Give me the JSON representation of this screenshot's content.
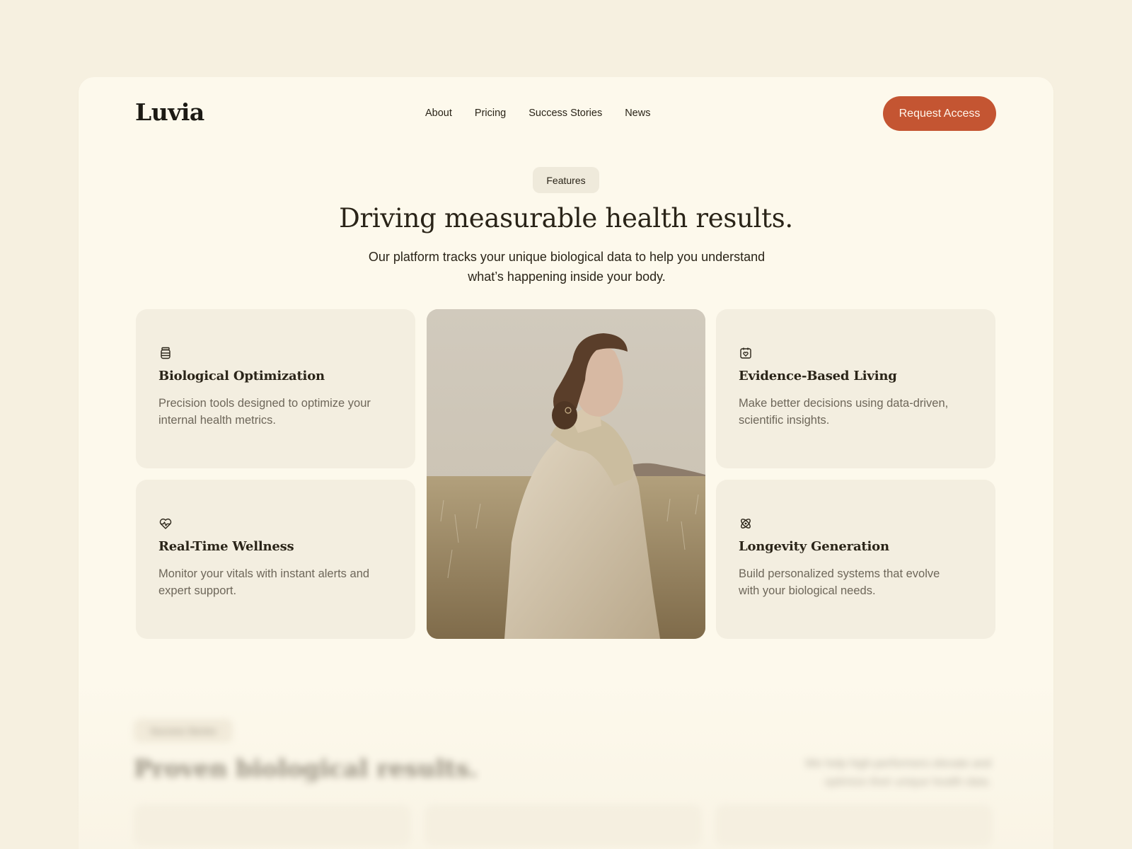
{
  "header": {
    "logo": "Luvia",
    "nav": [
      "About",
      "Pricing",
      "Success Stories",
      "News"
    ],
    "cta_label": "Request Access"
  },
  "hero": {
    "pill": "Features",
    "headline": "Driving measurable health results.",
    "subtitle_line1": "Our platform tracks your unique biological data to help you understand",
    "subtitle_line2": "what’s happening inside your body."
  },
  "features": [
    {
      "icon": "jar-icon",
      "title": "Biological Optimization",
      "text_line1": "Precision tools designed to optimize your",
      "text_line2": "internal health metrics."
    },
    {
      "icon": "calendar-heart-icon",
      "title": "Evidence-Based Living",
      "text_line1": "Make better decisions using data-driven,",
      "text_line2": "scientific insights."
    },
    {
      "icon": "heart-pulse-icon",
      "title": "Real-Time Wellness",
      "text_line1": "Monitor your vitals with instant alerts and",
      "text_line2": "expert support."
    },
    {
      "icon": "atom-icon",
      "title": "Longevity Generation",
      "text_line1": "Build personalized systems that evolve",
      "text_line2": "with your biological needs."
    }
  ],
  "next_section": {
    "pill": "Success Stories",
    "title": "Proven biological results.",
    "side_line1": "We help high-performers elevate and",
    "side_line2": "optimize their unique health data."
  },
  "colors": {
    "page_bg": "#f6f0e0",
    "frame_bg": "#fdf9ec",
    "card_bg": "#f3eee0",
    "accent": "#c45532",
    "text": "#2a2418",
    "muted": "#6e675a"
  }
}
